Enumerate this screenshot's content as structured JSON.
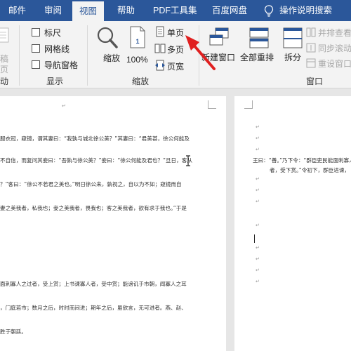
{
  "tabs": [
    "邮件",
    "审阅",
    "视图",
    "帮助",
    "PDF工具集",
    "百度网盘",
    "操作说明搜索"
  ],
  "ribbon": {
    "left_partial": {
      "top_label": "稿",
      "mid_label": "页",
      "group_label": "动"
    },
    "show_group": {
      "label": "显示",
      "items": [
        "标尺",
        "网格线",
        "导航窗格"
      ]
    },
    "zoom_group": {
      "label": "缩放",
      "zoom_btn": "缩放",
      "percent_btn": "100%",
      "single_page": "单页",
      "multi_page": "多页",
      "page_width": "页宽"
    },
    "window_group": {
      "label": "窗口",
      "new_window": "新建窗口",
      "arrange_all": "全部重排",
      "split": "拆分",
      "side_by_side": "并排查看",
      "sync_scroll": "同步滚动",
      "reset_pos": "重设窗口位置"
    }
  },
  "doc": {
    "page1_lines": [
      "服衣冠，窥镜，谓其妻曰：“我孰与城北徐公美？”其妻曰：“君美甚，徐公何能及",
      "不自信，而复问其妾曰：“吾孰与徐公美？”妾曰：“徐公何能及君也？”旦日，客从",
      "？”客曰：“徐公不若君之美也。”明日徐公来，孰视之，自以为不如；窥镜而自",
      "妻之美我者，私我也；妾之美我者，畏我也；客之美我者，欲有求于我也。”于是",
      "面刺寡人之过者，受上赏；上书谏寡人者，受中赏；能谤讥于市朝，闻寡人之耳",
      "，门庭若市；数月之后，时时而间进；期年之后，虽欲言，无可进者。燕、赵、",
      "胜于朝廷。"
    ],
    "page2_lines": [
      "王曰：“善。”乃下令：“群臣吏民能面刺寡人之",
      "者，受下赏。”令初下，群臣进谏，"
    ]
  },
  "colors": {
    "accent": "#2b579a",
    "arrow": "#e02020"
  }
}
